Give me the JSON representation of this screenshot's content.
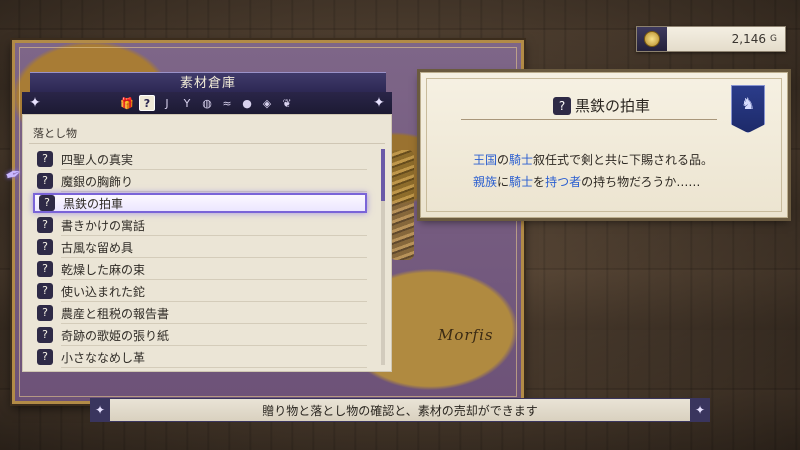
{
  "gold": {
    "amount": "2,146",
    "unit": "G",
    "icon": "gold-coin-icon"
  },
  "map": {
    "region_label": "Morfis"
  },
  "inventory": {
    "title": "素材倉庫",
    "categories": [
      {
        "icon": "gift-icon",
        "glyph": "🎁",
        "active": false
      },
      {
        "icon": "lost-item-bag-icon",
        "glyph": "?",
        "active": true
      },
      {
        "icon": "hook-icon",
        "glyph": "J",
        "active": false
      },
      {
        "icon": "sprout-icon",
        "glyph": "Y",
        "active": false
      },
      {
        "icon": "seed-icon",
        "glyph": "◍",
        "active": false
      },
      {
        "icon": "fish-icon",
        "glyph": "≈",
        "active": false
      },
      {
        "icon": "vegetable-icon",
        "glyph": "●",
        "active": false
      },
      {
        "icon": "ore-icon",
        "glyph": "◈",
        "active": false
      },
      {
        "icon": "leaf-icon",
        "glyph": "❦",
        "active": false
      }
    ],
    "section_heading": "落とし物",
    "items": [
      {
        "name": "四聖人の真実"
      },
      {
        "name": "魔銀の胸飾り"
      },
      {
        "name": "黒鉄の拍車"
      },
      {
        "name": "書きかけの寓話"
      },
      {
        "name": "古風な留め具"
      },
      {
        "name": "乾燥した麻の束"
      },
      {
        "name": "使い込まれた鉈"
      },
      {
        "name": "農産と租税の報告書"
      },
      {
        "name": "奇跡の歌姫の張り紙"
      },
      {
        "name": "小さななめし革"
      }
    ],
    "selected_index": 2,
    "item_glyph": "?"
  },
  "detail": {
    "title": "黒鉄の拍車",
    "line1": {
      "hl1": "王国",
      "t1": "の",
      "hl2": "騎士",
      "t2": "叙任式で剣と共に下賜される品。"
    },
    "line2": {
      "hl1": "親族",
      "t1": "に",
      "hl2": "騎士",
      "t2": "を",
      "hl3": "持つ者",
      "t3": "の持ち物だろうか……"
    },
    "crest": "house-crest-banner-icon"
  },
  "help": {
    "text": "贈り物と落とし物の確認と、素材の売却ができます"
  },
  "colors": {
    "accent": "#7a64d8",
    "highlight_text": "#2b5fd0",
    "panel_bg": "#ebe5d6",
    "header_bg": "#2a2550"
  }
}
